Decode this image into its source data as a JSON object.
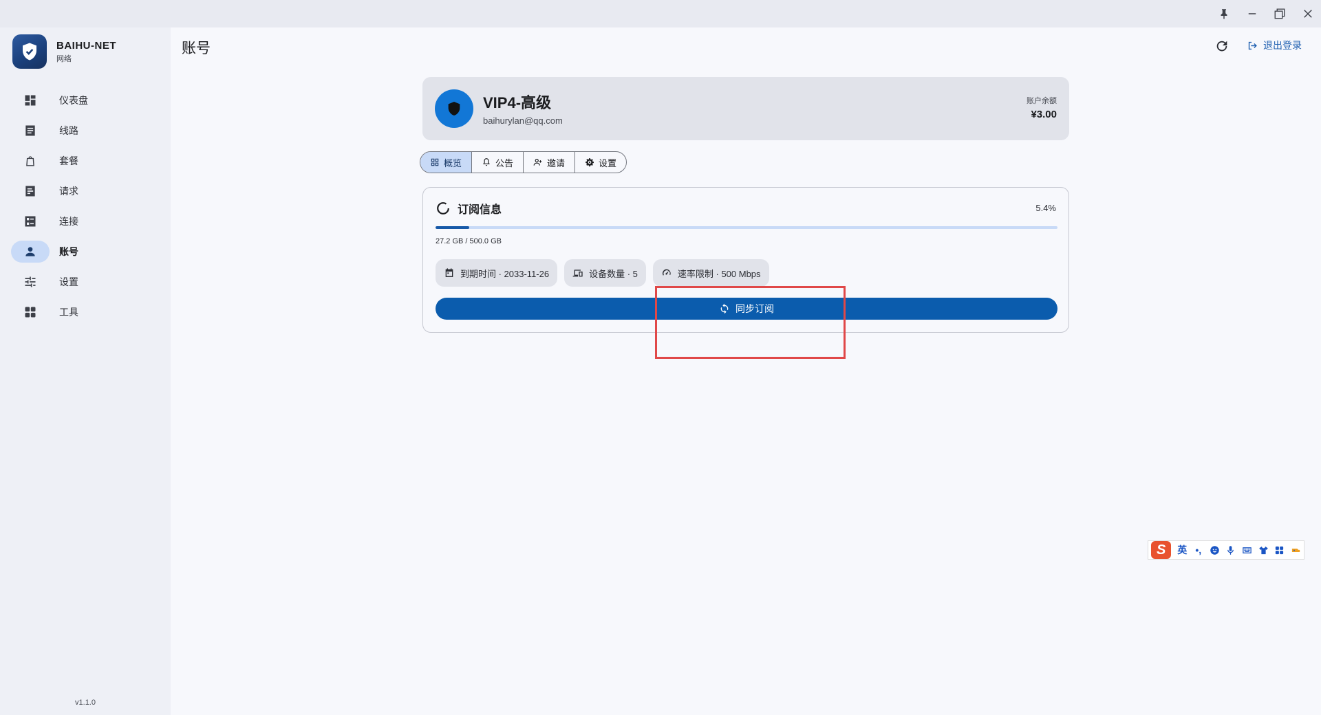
{
  "app": {
    "brand_name": "BAIHU-NET",
    "brand_sub": "网络",
    "version": "v1.1.0"
  },
  "window_controls": [
    "pin-icon",
    "minimize-icon",
    "maximize-icon",
    "close-icon"
  ],
  "sidebar": {
    "items": [
      {
        "label": "仪表盘",
        "icon": "dashboard-icon",
        "active": false
      },
      {
        "label": "线路",
        "icon": "routes-icon",
        "active": false
      },
      {
        "label": "套餐",
        "icon": "shopping-bag-icon",
        "active": false
      },
      {
        "label": "请求",
        "icon": "requests-icon",
        "active": false
      },
      {
        "label": "连接",
        "icon": "connections-icon",
        "active": false
      },
      {
        "label": "账号",
        "icon": "person-icon",
        "active": true
      },
      {
        "label": "设置",
        "icon": "sliders-icon",
        "active": false
      },
      {
        "label": "工具",
        "icon": "apps-icon",
        "active": false
      }
    ]
  },
  "header": {
    "title": "账号",
    "logout_label": "退出登录"
  },
  "profile": {
    "plan_name": "VIP4-高级",
    "email": "baihurylan@qq.com",
    "balance_label": "账户余额",
    "balance_value": "¥3.00"
  },
  "tabs": [
    {
      "label": "概览",
      "icon": "grid-icon",
      "active": true
    },
    {
      "label": "公告",
      "icon": "bell-icon",
      "active": false
    },
    {
      "label": "邀请",
      "icon": "invite-icon",
      "active": false
    },
    {
      "label": "设置",
      "icon": "gear-icon",
      "active": false
    }
  ],
  "subscription": {
    "title": "订阅信息",
    "percent_text": "5.4%",
    "progress_fraction": 0.054,
    "usage_text": "27.2 GB / 500.0 GB",
    "chips": [
      {
        "label": "到期时间 · 2033-11-26",
        "icon": "calendar-icon"
      },
      {
        "label": "设备数量 · 5",
        "icon": "devices-icon"
      },
      {
        "label": "速率限制 · 500 Mbps",
        "icon": "speedometer-icon"
      }
    ],
    "sync_label": "同步订阅"
  },
  "ime": {
    "mode_label": "英",
    "punct_label": "•,"
  },
  "colors": {
    "accent": "#0b5cad",
    "highlight": "#e04848",
    "active_nav_bg": "#c8daf7"
  }
}
